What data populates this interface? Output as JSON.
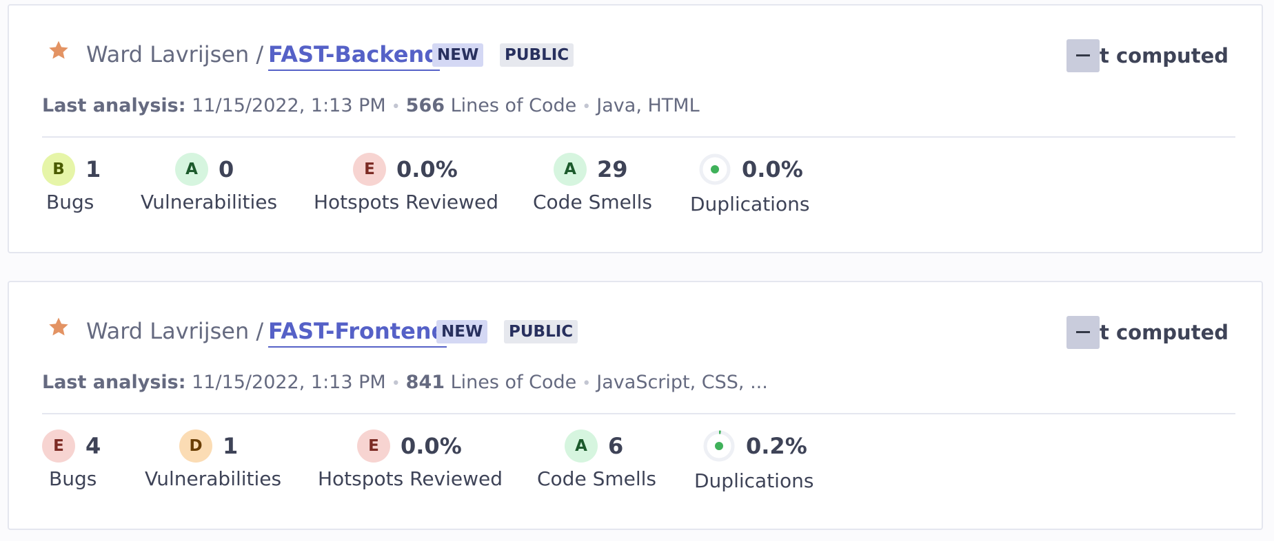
{
  "projects": [
    {
      "owner": "Ward Lavrijsen",
      "separator": "/",
      "name": "FAST-Backend",
      "badge_new": "NEW",
      "badge_visibility": "PUBLIC",
      "quality_gate": "Not computed",
      "last_analysis_label": "Last analysis:",
      "last_analysis": "11/15/2022, 1:13 PM",
      "loc_value": "566",
      "loc_label": "Lines of Code",
      "languages": "Java, HTML",
      "metrics": {
        "bugs": {
          "rating": "B",
          "value": "1",
          "label": "Bugs"
        },
        "vulnerabilities": {
          "rating": "A",
          "value": "0",
          "label": "Vulnerabilities"
        },
        "hotspots": {
          "rating": "E",
          "value": "0.0%",
          "label": "Hotspots Reviewed"
        },
        "code_smells": {
          "rating": "A",
          "value": "29",
          "label": "Code Smells"
        },
        "duplications": {
          "value": "0.0%",
          "label": "Duplications",
          "fraction": 0.0
        }
      }
    },
    {
      "owner": "Ward Lavrijsen",
      "separator": "/",
      "name": "FAST-Frontend",
      "badge_new": "NEW",
      "badge_visibility": "PUBLIC",
      "quality_gate": "Not computed",
      "last_analysis_label": "Last analysis:",
      "last_analysis": "11/15/2022, 1:13 PM",
      "loc_value": "841",
      "loc_label": "Lines of Code",
      "languages": "JavaScript, CSS, ...",
      "metrics": {
        "bugs": {
          "rating": "E",
          "value": "4",
          "label": "Bugs"
        },
        "vulnerabilities": {
          "rating": "D",
          "value": "1",
          "label": "Vulnerabilities"
        },
        "hotspots": {
          "rating": "E",
          "value": "0.0%",
          "label": "Hotspots Reviewed"
        },
        "code_smells": {
          "rating": "A",
          "value": "6",
          "label": "Code Smells"
        },
        "duplications": {
          "value": "0.2%",
          "label": "Duplications",
          "fraction": 0.02
        }
      }
    }
  ],
  "colors": {
    "accent_link": "#5561c7",
    "star": "#e39363",
    "dup_green": "#3fb15a",
    "dup_ring": "#eef0f5"
  },
  "icons": {
    "star": "star-icon",
    "quality_gate": "minus-icon",
    "duplications": "duplication-ring-icon"
  }
}
